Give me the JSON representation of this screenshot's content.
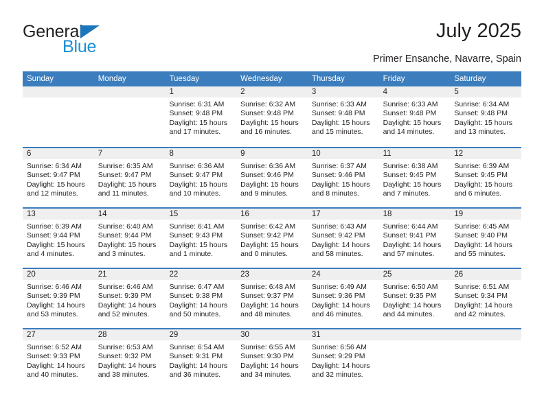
{
  "logo": {
    "word_top": "General",
    "word_bottom": "Blue",
    "triangle_color": "#1b75bb",
    "blue_text_color": "#1b8fd6"
  },
  "header": {
    "title": "July 2025",
    "subtitle": "Primer Ensanche, Navarre, Spain",
    "accent_color": "#3b7dbd",
    "band_color": "#efefef"
  },
  "weekdays": [
    "Sunday",
    "Monday",
    "Tuesday",
    "Wednesday",
    "Thursday",
    "Friday",
    "Saturday"
  ],
  "weeks": [
    [
      {
        "day": "",
        "lines": []
      },
      {
        "day": "",
        "lines": []
      },
      {
        "day": "1",
        "lines": [
          "Sunrise: 6:31 AM",
          "Sunset: 9:48 PM",
          "Daylight: 15 hours",
          "and 17 minutes."
        ]
      },
      {
        "day": "2",
        "lines": [
          "Sunrise: 6:32 AM",
          "Sunset: 9:48 PM",
          "Daylight: 15 hours",
          "and 16 minutes."
        ]
      },
      {
        "day": "3",
        "lines": [
          "Sunrise: 6:33 AM",
          "Sunset: 9:48 PM",
          "Daylight: 15 hours",
          "and 15 minutes."
        ]
      },
      {
        "day": "4",
        "lines": [
          "Sunrise: 6:33 AM",
          "Sunset: 9:48 PM",
          "Daylight: 15 hours",
          "and 14 minutes."
        ]
      },
      {
        "day": "5",
        "lines": [
          "Sunrise: 6:34 AM",
          "Sunset: 9:48 PM",
          "Daylight: 15 hours",
          "and 13 minutes."
        ]
      }
    ],
    [
      {
        "day": "6",
        "lines": [
          "Sunrise: 6:34 AM",
          "Sunset: 9:47 PM",
          "Daylight: 15 hours",
          "and 12 minutes."
        ]
      },
      {
        "day": "7",
        "lines": [
          "Sunrise: 6:35 AM",
          "Sunset: 9:47 PM",
          "Daylight: 15 hours",
          "and 11 minutes."
        ]
      },
      {
        "day": "8",
        "lines": [
          "Sunrise: 6:36 AM",
          "Sunset: 9:47 PM",
          "Daylight: 15 hours",
          "and 10 minutes."
        ]
      },
      {
        "day": "9",
        "lines": [
          "Sunrise: 6:36 AM",
          "Sunset: 9:46 PM",
          "Daylight: 15 hours",
          "and 9 minutes."
        ]
      },
      {
        "day": "10",
        "lines": [
          "Sunrise: 6:37 AM",
          "Sunset: 9:46 PM",
          "Daylight: 15 hours",
          "and 8 minutes."
        ]
      },
      {
        "day": "11",
        "lines": [
          "Sunrise: 6:38 AM",
          "Sunset: 9:45 PM",
          "Daylight: 15 hours",
          "and 7 minutes."
        ]
      },
      {
        "day": "12",
        "lines": [
          "Sunrise: 6:39 AM",
          "Sunset: 9:45 PM",
          "Daylight: 15 hours",
          "and 6 minutes."
        ]
      }
    ],
    [
      {
        "day": "13",
        "lines": [
          "Sunrise: 6:39 AM",
          "Sunset: 9:44 PM",
          "Daylight: 15 hours",
          "and 4 minutes."
        ]
      },
      {
        "day": "14",
        "lines": [
          "Sunrise: 6:40 AM",
          "Sunset: 9:44 PM",
          "Daylight: 15 hours",
          "and 3 minutes."
        ]
      },
      {
        "day": "15",
        "lines": [
          "Sunrise: 6:41 AM",
          "Sunset: 9:43 PM",
          "Daylight: 15 hours",
          "and 1 minute."
        ]
      },
      {
        "day": "16",
        "lines": [
          "Sunrise: 6:42 AM",
          "Sunset: 9:42 PM",
          "Daylight: 15 hours",
          "and 0 minutes."
        ]
      },
      {
        "day": "17",
        "lines": [
          "Sunrise: 6:43 AM",
          "Sunset: 9:42 PM",
          "Daylight: 14 hours",
          "and 58 minutes."
        ]
      },
      {
        "day": "18",
        "lines": [
          "Sunrise: 6:44 AM",
          "Sunset: 9:41 PM",
          "Daylight: 14 hours",
          "and 57 minutes."
        ]
      },
      {
        "day": "19",
        "lines": [
          "Sunrise: 6:45 AM",
          "Sunset: 9:40 PM",
          "Daylight: 14 hours",
          "and 55 minutes."
        ]
      }
    ],
    [
      {
        "day": "20",
        "lines": [
          "Sunrise: 6:46 AM",
          "Sunset: 9:39 PM",
          "Daylight: 14 hours",
          "and 53 minutes."
        ]
      },
      {
        "day": "21",
        "lines": [
          "Sunrise: 6:46 AM",
          "Sunset: 9:39 PM",
          "Daylight: 14 hours",
          "and 52 minutes."
        ]
      },
      {
        "day": "22",
        "lines": [
          "Sunrise: 6:47 AM",
          "Sunset: 9:38 PM",
          "Daylight: 14 hours",
          "and 50 minutes."
        ]
      },
      {
        "day": "23",
        "lines": [
          "Sunrise: 6:48 AM",
          "Sunset: 9:37 PM",
          "Daylight: 14 hours",
          "and 48 minutes."
        ]
      },
      {
        "day": "24",
        "lines": [
          "Sunrise: 6:49 AM",
          "Sunset: 9:36 PM",
          "Daylight: 14 hours",
          "and 46 minutes."
        ]
      },
      {
        "day": "25",
        "lines": [
          "Sunrise: 6:50 AM",
          "Sunset: 9:35 PM",
          "Daylight: 14 hours",
          "and 44 minutes."
        ]
      },
      {
        "day": "26",
        "lines": [
          "Sunrise: 6:51 AM",
          "Sunset: 9:34 PM",
          "Daylight: 14 hours",
          "and 42 minutes."
        ]
      }
    ],
    [
      {
        "day": "27",
        "lines": [
          "Sunrise: 6:52 AM",
          "Sunset: 9:33 PM",
          "Daylight: 14 hours",
          "and 40 minutes."
        ]
      },
      {
        "day": "28",
        "lines": [
          "Sunrise: 6:53 AM",
          "Sunset: 9:32 PM",
          "Daylight: 14 hours",
          "and 38 minutes."
        ]
      },
      {
        "day": "29",
        "lines": [
          "Sunrise: 6:54 AM",
          "Sunset: 9:31 PM",
          "Daylight: 14 hours",
          "and 36 minutes."
        ]
      },
      {
        "day": "30",
        "lines": [
          "Sunrise: 6:55 AM",
          "Sunset: 9:30 PM",
          "Daylight: 14 hours",
          "and 34 minutes."
        ]
      },
      {
        "day": "31",
        "lines": [
          "Sunrise: 6:56 AM",
          "Sunset: 9:29 PM",
          "Daylight: 14 hours",
          "and 32 minutes."
        ]
      },
      {
        "day": "",
        "lines": []
      },
      {
        "day": "",
        "lines": []
      }
    ]
  ]
}
